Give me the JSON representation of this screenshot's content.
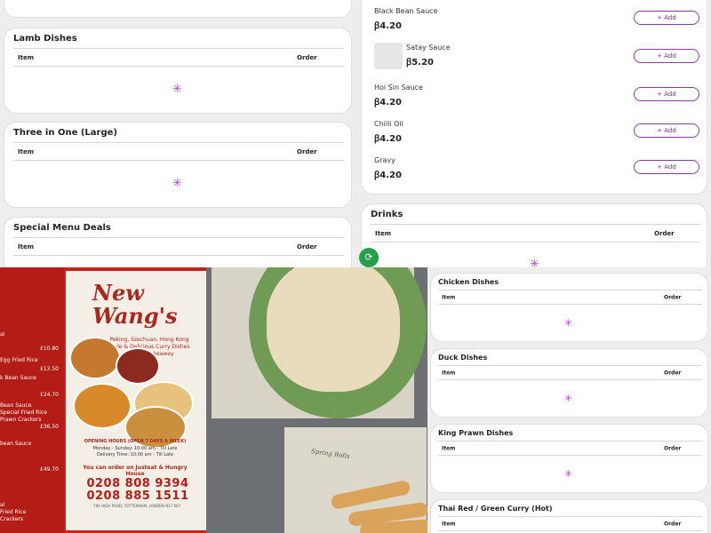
{
  "colors": {
    "accent": "#b53ad0",
    "button_border": "#8e3aa8",
    "fab": "#22a04b",
    "menu_red": "#c7231c"
  },
  "top_left": {
    "cards": [
      {
        "title": "Lamb Dishes",
        "item_header": "Item",
        "order_header": "Order"
      },
      {
        "title": "Three in One (Large)",
        "item_header": "Item",
        "order_header": "Order"
      },
      {
        "title": "Special Menu Deals",
        "item_header": "Item",
        "order_header": "Order"
      }
    ]
  },
  "top_right": {
    "add_label": "Add",
    "sauces": [
      {
        "name": "Black Bean Sauce",
        "price": "ꞵ4.20"
      },
      {
        "name": "Satay Sauce",
        "price": "ꞵ5.20"
      },
      {
        "name": "Hoi Sin Sauce",
        "price": "ꞵ4.20"
      },
      {
        "name": "Chilli Oil",
        "price": "ꞵ4.20"
      },
      {
        "name": "Gravy",
        "price": "ꞵ4.20"
      }
    ],
    "drinks": {
      "title": "Drinks",
      "item_header": "Item",
      "order_header": "Order"
    }
  },
  "bottom_right": {
    "cards": [
      {
        "title": "Chicken Dishes",
        "item_header": "Item",
        "order_header": "Order"
      },
      {
        "title": "Duck Dishes",
        "item_header": "Item",
        "order_header": "Order"
      },
      {
        "title": "King Prawn Dishes",
        "item_header": "Item",
        "order_header": "Order"
      },
      {
        "title": "Thai Red / Green Curry (Hot)",
        "item_header": "Item",
        "order_header": "Order"
      }
    ]
  },
  "photo": {
    "logo": "New Wang's",
    "subtitle": "Peking, Szechuan, Hong Kong Style & Delicious Curry Dishes Chinese Takeaway",
    "hours_title": "OPENING HOURS (OPEN 7 DAYS A WEEK)",
    "hours_lines": [
      "Monday - Sunday: 10:00 am - Till Late",
      "Delivery Time: 10:00 am - Till Late"
    ],
    "order_note": "You can order on Justeat & Hungry House",
    "phones": [
      "0208 808 9394",
      "0208 885 1511"
    ],
    "address": "78A HIGH ROAD, TOTTENHAM, LONDON N17 6EY",
    "left_prices": [
      "£10.80",
      "£13.50",
      "£24.70",
      "£36.50",
      "£49.70"
    ],
    "left_labels": [
      "al",
      "Egg Fried Rice",
      "k Bean Sauce",
      "Bean Sauce",
      "Special Fried Rice",
      "Prawn Crackers",
      "bean Sauce",
      "al",
      "Fried Rice",
      "Crackers"
    ],
    "spring_label": "Spring Rolls"
  }
}
